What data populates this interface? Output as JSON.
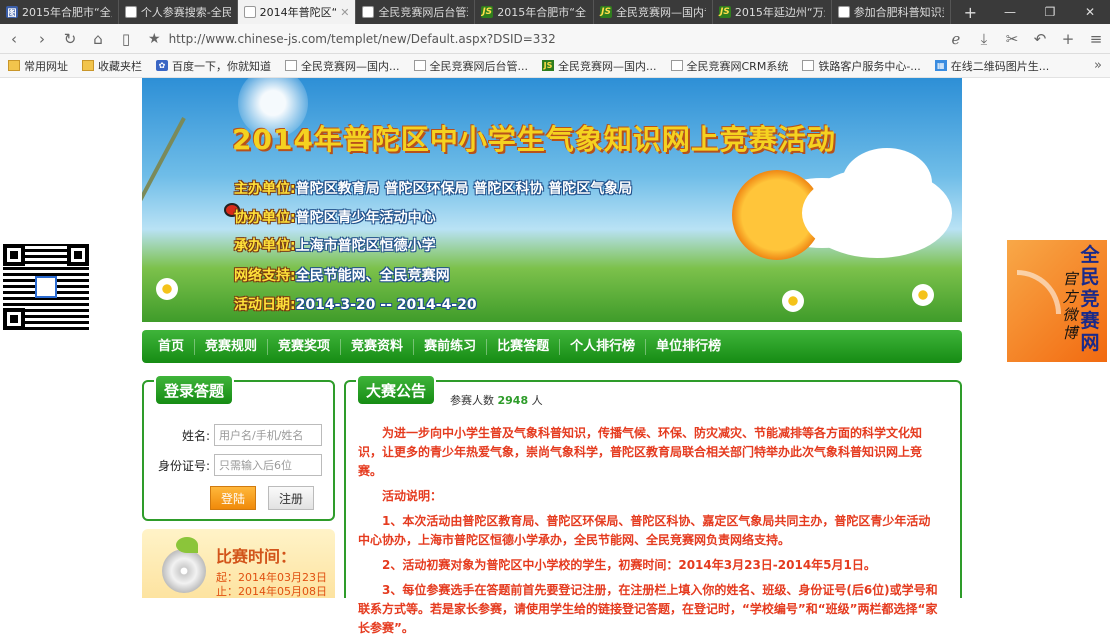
{
  "browser": {
    "tabs": [
      {
        "label": "2015年合肥市“全民",
        "icon": "img-icon",
        "active": false
      },
      {
        "label": "个人参赛搜索-全民",
        "icon": "page-icon",
        "active": false
      },
      {
        "label": "2014年普陀区“气",
        "icon": "page-icon",
        "active": true
      },
      {
        "label": "全民竞赛网后台管理",
        "icon": "page-icon",
        "active": false
      },
      {
        "label": "2015年合肥市“全民",
        "icon": "js-icon",
        "active": false
      },
      {
        "label": "全民竞赛网—国内专",
        "icon": "js-icon",
        "active": false
      },
      {
        "label": "2015年延边州“万众",
        "icon": "js-icon",
        "active": false
      },
      {
        "label": "参加合肥科普知识竞",
        "icon": "page-icon",
        "active": false
      }
    ],
    "url": "http://www.chinese-js.com/templet/new/Default.aspx?DSID=332",
    "bookmarks": [
      {
        "label": "常用网址",
        "icon": "folder"
      },
      {
        "label": "收藏夹栏",
        "icon": "folder"
      },
      {
        "label": "百度一下，你就知道",
        "icon": "paw"
      },
      {
        "label": "全民竞赛网—国内...",
        "icon": "page"
      },
      {
        "label": "全民竞赛网后台管...",
        "icon": "page"
      },
      {
        "label": "全民竞赛网—国内...",
        "icon": "js"
      },
      {
        "label": "全民竞赛网CRM系统",
        "icon": "page"
      },
      {
        "label": "铁路客户服务中心-...",
        "icon": "page"
      },
      {
        "label": "在线二维码图片生...",
        "icon": "qr"
      }
    ]
  },
  "banner": {
    "title": "2014年普陀区中小学生气象知识网上竞赛活动",
    "lines": [
      {
        "label": "主办单位:",
        "value": "普陀区教育局 普陀区环保局 普陀区科协 普陀区气象局"
      },
      {
        "label": "协办单位:",
        "value": "普陀区青少年活动中心"
      },
      {
        "label": "承办单位:",
        "value": "上海市普陀区恒德小学"
      },
      {
        "label": "网络支持:",
        "value": "全民节能网、全民竞赛网"
      },
      {
        "label": "活动日期:",
        "value": "2014-3-20 -- 2014-4-20"
      }
    ]
  },
  "menu": [
    "首页",
    "竞赛规则",
    "竞赛奖项",
    "竞赛资料",
    "赛前练习",
    "比赛答题",
    "个人排行榜",
    "单位排行榜"
  ],
  "side_ad": {
    "title": "全民竞赛网",
    "sub": "官方微博"
  },
  "login": {
    "title": "登录答题",
    "name_label": "姓名:",
    "name_placeholder": "用户名/手机/姓名",
    "id_label": "身份证号:",
    "id_placeholder": "只需输入后6位",
    "login_btn": "登陆",
    "register_btn": "注册"
  },
  "time_box": {
    "title": "比赛时间：",
    "start": "起：2014年03月23日",
    "end": "止：2014年05月08日"
  },
  "notice": {
    "title": "大赛公告",
    "participants_label": "参赛人数",
    "participants_count": "2948",
    "participants_unit": "人",
    "p1": "为进一步向中小学生普及气象科普知识，传播气候、环保、防灾减灾、节能减排等各方面的科学文化知识，让更多的青少年热爱气象，崇尚气象科学，普陀区教育局联合相关部门特举办此次气象科普知识网上竞赛。",
    "p2": "活动说明：",
    "p3": "1、本次活动由普陀区教育局、普陀区环保局、普陀区科协、嘉定区气象局共同主办，普陀区青少年活动中心协办，上海市普陀区恒德小学承办，全民节能网、全民竞赛网负责网络支持。",
    "p4": "2、活动初赛对象为普陀区中小学校的学生，初赛时间：2014年3月23日-2014年5月1日。",
    "p5": "3、每位参赛选手在答题前首先要登记注册，在注册栏上填入你的姓名、班级、身份证号(后6位)或学号和联系方式等。若是家长参赛，请使用学生给的链接登记答题，在登记时，“学校编号”和“班级”两栏都选择“家长参赛”。"
  }
}
